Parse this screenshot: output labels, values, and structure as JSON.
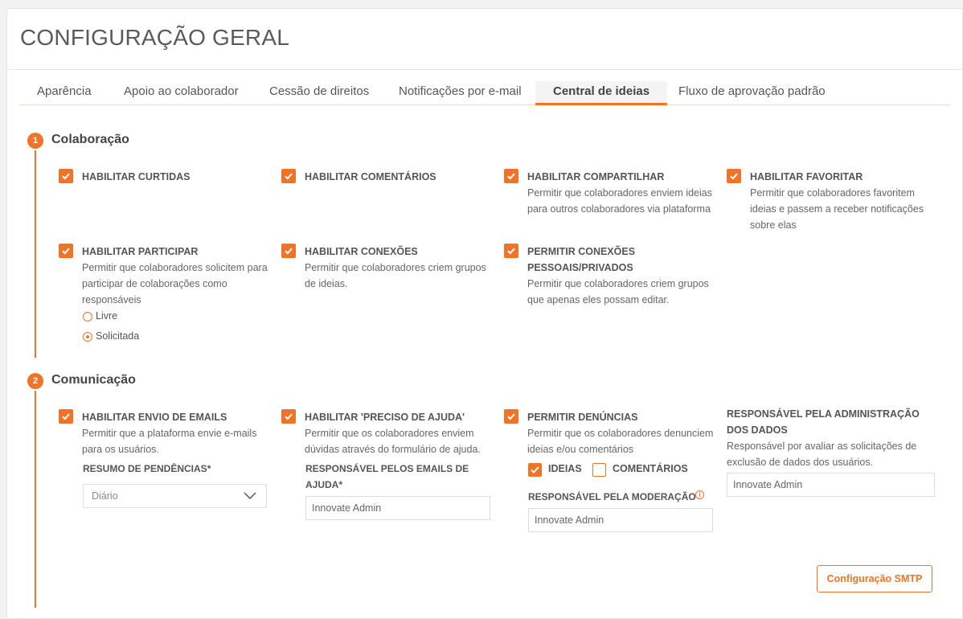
{
  "page": {
    "title": "CONFIGURAÇÃO GERAL"
  },
  "tabs": [
    {
      "label": "Aparência"
    },
    {
      "label": "Apoio ao colaborador"
    },
    {
      "label": "Cessão de direitos"
    },
    {
      "label": "Notificações por e-mail"
    },
    {
      "label": "Central de ideias",
      "active": true
    },
    {
      "label": "Fluxo de aprovação padrão"
    }
  ],
  "colaboracao": {
    "step": "1",
    "title": "Colaboração",
    "options": [
      {
        "label": "HABILITAR CURTIDAS",
        "desc": "",
        "checked": true
      },
      {
        "label": "HABILITAR COMENTÁRIOS",
        "desc": "",
        "checked": true
      },
      {
        "label": "HABILITAR COMPARTILHAR",
        "desc": "Permitir que colaboradores enviem ideias para outros colaboradores via plataforma",
        "checked": true
      },
      {
        "label": "HABILITAR FAVORITAR",
        "desc": "Permitir que colaboradores favoritem ideias e passem a receber notificações sobre elas",
        "checked": true
      },
      {
        "label": "HABILITAR PARTICIPAR",
        "desc": "Permitir que colaboradores solicitem para participar de colaborações como responsáveis",
        "checked": true
      },
      {
        "label": "HABILITAR CONEXÕES",
        "desc": "Permitir que colaboradores criem grupos de ideias.",
        "checked": true
      },
      {
        "label": "PERMITIR CONEXÕES PESSOAIS/PRIVADOS",
        "desc": "Permitir que colaboradores criem grupos que apenas eles possam editar.",
        "checked": true
      }
    ],
    "participar_modes": [
      {
        "label": "Livre",
        "selected": false
      },
      {
        "label": "Solicitada",
        "selected": true
      }
    ]
  },
  "comunicacao": {
    "step": "2",
    "title": "Comunicação",
    "options": [
      {
        "label": "HABILITAR ENVIO DE EMAILS",
        "desc": "Permitir que a plataforma envie e-mails para os usuários.",
        "checked": true
      },
      {
        "label": "HABILITAR 'PRECISO DE AJUDA'",
        "desc": "Permitir que os colaboradores enviem dúvidas através do formulário de ajuda.",
        "checked": true
      },
      {
        "label": "PERMITIR DENÚNCIAS",
        "desc": "Permitir que os colaboradores denunciem ideias e/ou comentários",
        "checked": true
      },
      {
        "label": "RESPONSÁVEL PELA ADMINISTRAÇÃO DOS DADOS",
        "desc": "Responsável por avaliar as solicitações de exclusão de dados dos usuários."
      }
    ],
    "resumo_label": "RESUMO DE PENDÊNCIAS*",
    "resumo_value": "Diário",
    "ajuda_label": "RESPONSÁVEL PELOS EMAILS DE AJUDA*",
    "ajuda_value": "Innovate Admin",
    "denuncia_targets": [
      {
        "label": "IDEIAS",
        "checked": true
      },
      {
        "label": "COMENTÁRIOS",
        "checked": false
      }
    ],
    "moderacao_label": "RESPONSÁVEL PELA MODERAÇÃO",
    "moderacao_value": "Innovate Admin",
    "admin_value": "Innovate Admin",
    "smtp_button": "Configuração SMTP"
  },
  "colors": {
    "accent": "#f07328"
  }
}
